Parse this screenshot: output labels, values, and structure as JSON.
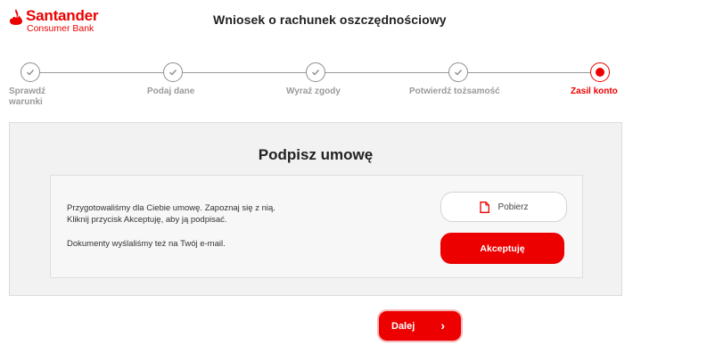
{
  "header": {
    "brand_name": "Santander",
    "brand_sub": "Consumer Bank",
    "title": "Wniosek o rachunek oszczędnościowy"
  },
  "stepper": {
    "steps": [
      {
        "label_line1": "Sprawdź",
        "label_line2": "warunki",
        "state": "done"
      },
      {
        "label_line1": "Podaj dane",
        "label_line2": "",
        "state": "done"
      },
      {
        "label_line1": "Wyraź zgody",
        "label_line2": "",
        "state": "done"
      },
      {
        "label_line1": "Potwierdź tożsamość",
        "label_line2": "",
        "state": "done"
      },
      {
        "label_line1": "Zasil konto",
        "label_line2": "",
        "state": "active"
      }
    ]
  },
  "panel": {
    "title": "Podpisz umowę",
    "text_line1": "Przygotowaliśmy dla Ciebie umowę. Zapoznaj się z nią.",
    "text_line2": "Kliknij przycisk Akceptuję, aby ją podpisać.",
    "text_line3": "Dokumenty wyślaliśmy też na Twój e-mail.",
    "download_label": "Pobierz",
    "accept_label": "Akceptuję"
  },
  "footer": {
    "next_label": "Dalej",
    "next_icon": "chevron-right-icon"
  },
  "colors": {
    "accent": "#ec0000",
    "muted": "#9a9a9a",
    "panel_bg": "#f2f2f2"
  }
}
